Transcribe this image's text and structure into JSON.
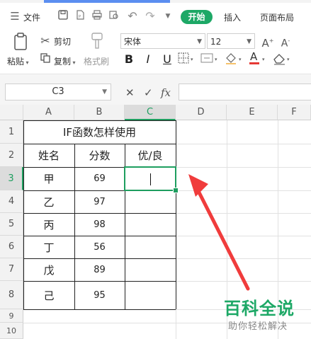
{
  "menu": {
    "file_label": "文件",
    "tabs": [
      "开始",
      "插入",
      "页面布局"
    ]
  },
  "ribbon": {
    "paste": "粘贴",
    "cut": "剪切",
    "copy": "复制",
    "format_painter": "格式刷",
    "font_name": "宋体",
    "font_size": "12"
  },
  "formula_bar": {
    "name_box": "C3",
    "formula": ""
  },
  "sheet": {
    "columns": [
      "A",
      "B",
      "C",
      "D",
      "E",
      "F"
    ],
    "rows": [
      "1",
      "2",
      "3",
      "4",
      "5",
      "6",
      "7",
      "8",
      "9",
      "10"
    ],
    "selected_cell": "C3",
    "title": "IF函数怎样使用",
    "headers": [
      "姓名",
      "分数",
      "优/良"
    ],
    "data": [
      {
        "name": "甲",
        "score": "69"
      },
      {
        "name": "乙",
        "score": "97"
      },
      {
        "name": "丙",
        "score": "98"
      },
      {
        "name": "丁",
        "score": "56"
      },
      {
        "name": "戊",
        "score": "89"
      },
      {
        "name": "己",
        "score": "95"
      }
    ]
  },
  "annotation": {
    "arrow_color": "#f03c3c"
  },
  "watermark": {
    "brand": "百科全说",
    "slogan": "助你轻松解决"
  },
  "colors": {
    "accent": "#1da866",
    "selection": "#1e9e5f"
  }
}
